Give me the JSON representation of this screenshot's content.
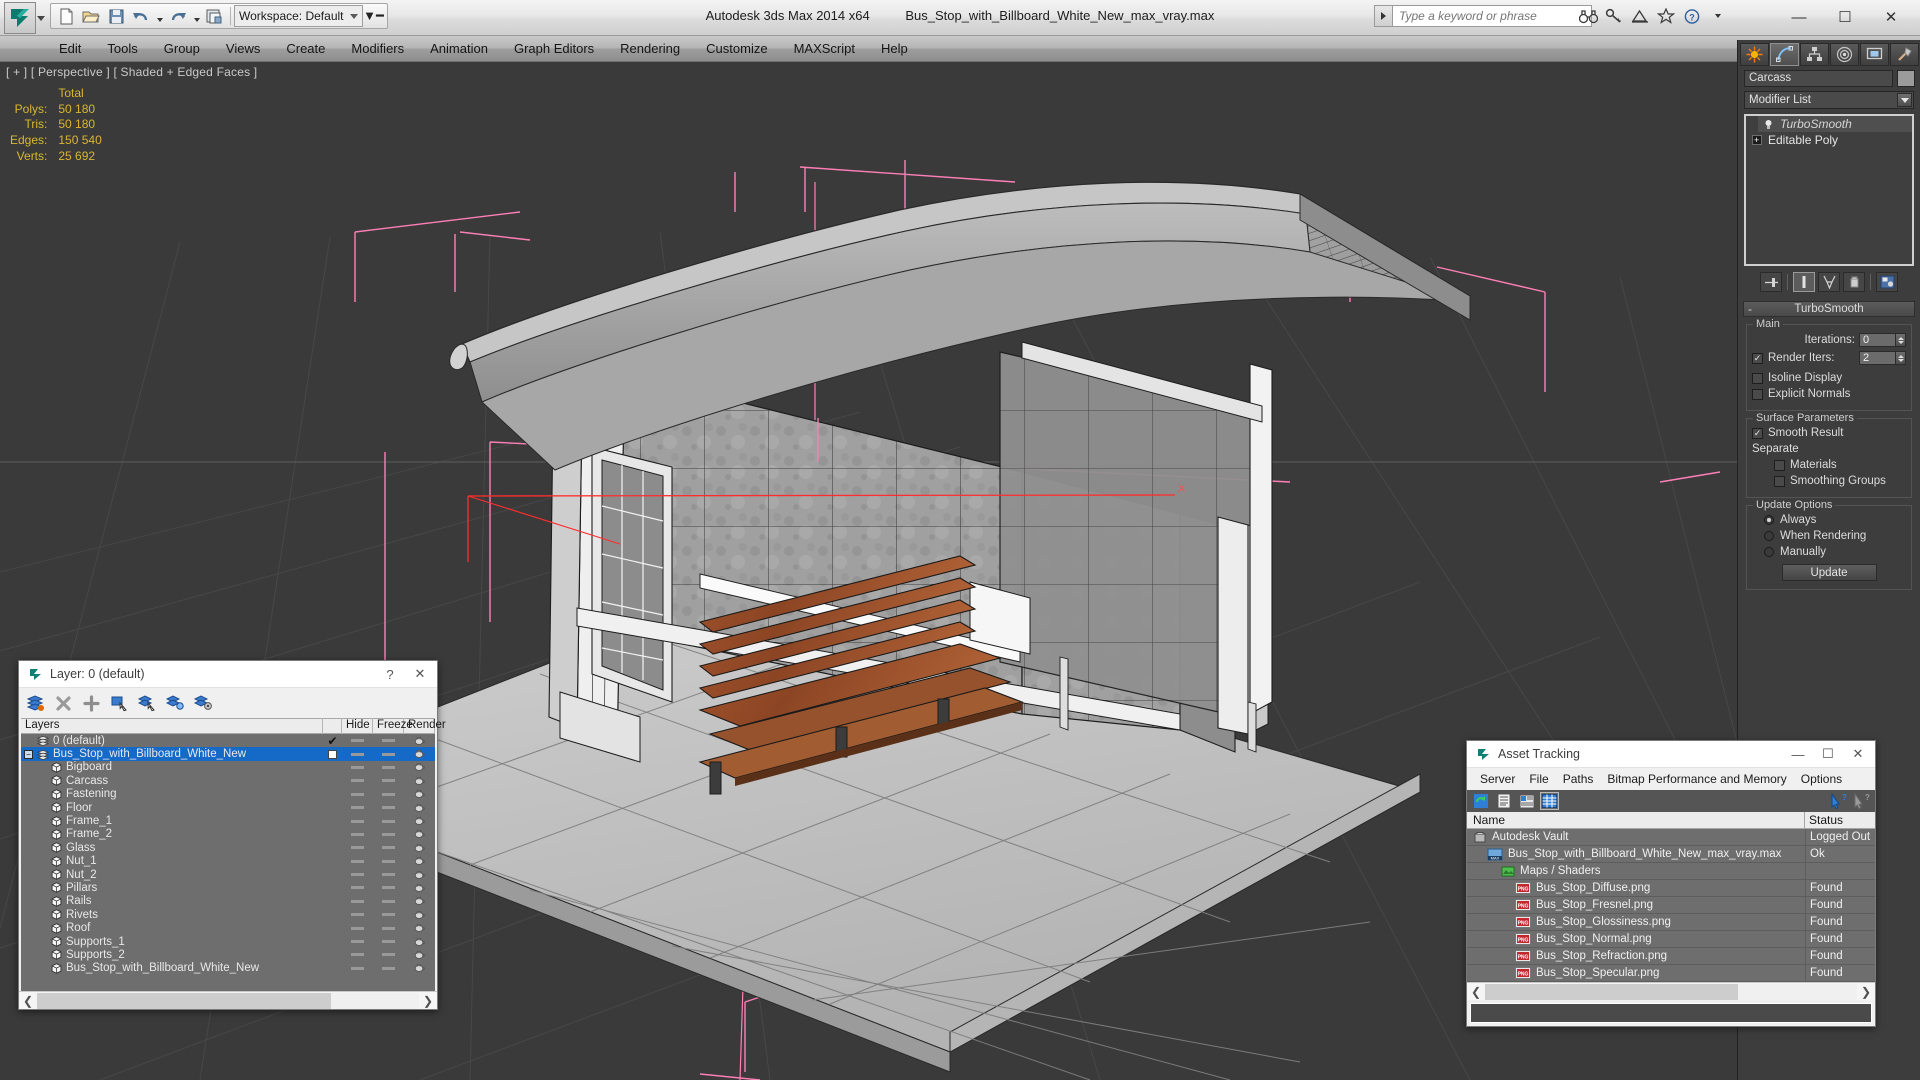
{
  "app": {
    "title": "Autodesk 3ds Max  2014 x64",
    "file": "Bus_Stop_with_Billboard_White_New_max_vray.max",
    "workspace_label": "Workspace: Default",
    "search_placeholder": "Type a keyword or phrase"
  },
  "quick_access": [
    {
      "name": "new-file-icon",
      "label": "New"
    },
    {
      "name": "open-file-icon",
      "label": "Open"
    },
    {
      "name": "save-file-icon",
      "label": "Save"
    },
    {
      "name": "undo-icon",
      "label": "Undo"
    },
    {
      "name": "redo-icon",
      "label": "Redo"
    },
    {
      "name": "project-folder-icon",
      "label": "Set Project Folder"
    }
  ],
  "title_icons": [
    {
      "name": "binoculars-icon"
    },
    {
      "name": "key-icon"
    },
    {
      "name": "satellite-dish-icon"
    },
    {
      "name": "star-icon"
    },
    {
      "name": "help-circle-icon"
    }
  ],
  "window_buttons": {
    "minimize": "—",
    "maximize": "☐",
    "close": "✕"
  },
  "menu": [
    "Edit",
    "Tools",
    "Group",
    "Views",
    "Create",
    "Modifiers",
    "Animation",
    "Graph Editors",
    "Rendering",
    "Customize",
    "MAXScript",
    "Help"
  ],
  "viewport": {
    "label": "[ + ] [ Perspective ] [ Shaded + Edged Faces ]",
    "stats_header": "Total",
    "stats": [
      {
        "label": "Polys:",
        "value": "50 180"
      },
      {
        "label": "Tris:",
        "value": "50 180"
      },
      {
        "label": "Edges:",
        "value": "150 540"
      },
      {
        "label": "Verts:",
        "value": "25 692"
      }
    ],
    "axis_label_x": "X",
    "colors": {
      "background": "#3a3a3a",
      "selection_bracket": "#ff7fb7",
      "gizmo_x": "#ff2d2d",
      "gizmo_z": "#ff7fb7",
      "stats_text": "#d8b72e",
      "wood": "#8f4a27",
      "floor": "#c4c4c4",
      "wall": "#9a9a9a",
      "roof": "#a9a9a9"
    }
  },
  "command_panel": {
    "tabs": [
      {
        "name": "create-tab",
        "icon": "star-burst-icon",
        "active": false
      },
      {
        "name": "modify-tab",
        "icon": "curve-icon",
        "active": true
      },
      {
        "name": "hierarchy-tab",
        "icon": "hierarchy-icon",
        "active": false
      },
      {
        "name": "motion-tab",
        "icon": "motion-icon",
        "active": false
      },
      {
        "name": "display-tab",
        "icon": "display-icon",
        "active": false
      },
      {
        "name": "utilities-tab",
        "icon": "hammer-icon",
        "active": false
      }
    ],
    "object_name": "Carcass",
    "modifier_list_label": "Modifier List",
    "stack": [
      {
        "label": "TurboSmooth",
        "selected": true,
        "icon": "lightbulb-icon"
      },
      {
        "label": "Editable Poly",
        "selected": false,
        "icon": "plus-box-icon"
      }
    ],
    "stack_buttons": [
      {
        "name": "pin-stack-button"
      },
      {
        "name": "show-end-result-button",
        "active": true
      },
      {
        "name": "make-unique-button"
      },
      {
        "name": "remove-modifier-button"
      },
      {
        "name": "configure-modifier-sets-button"
      }
    ],
    "rollout": {
      "title": "TurboSmooth",
      "groups": {
        "main": {
          "title": "Main",
          "iterations_label": "Iterations:",
          "iterations_value": "0",
          "render_iters_label": "Render Iters:",
          "render_iters_value": "2",
          "render_iters_checked": true,
          "isoline_display_label": "Isoline Display",
          "isoline_display_checked": false,
          "explicit_normals_label": "Explicit Normals",
          "explicit_normals_checked": false
        },
        "surface": {
          "title": "Surface Parameters",
          "smooth_result_label": "Smooth Result",
          "smooth_result_checked": true,
          "separate_label": "Separate",
          "materials_label": "Materials",
          "materials_checked": false,
          "smoothing_groups_label": "Smoothing Groups",
          "smoothing_groups_checked": false
        },
        "update": {
          "title": "Update Options",
          "options": [
            "Always",
            "When Rendering",
            "Manually"
          ],
          "selected": "Always",
          "update_button": "Update"
        }
      }
    }
  },
  "layer_dialog": {
    "title": "Layer: 0 (default)",
    "help_btn": "?",
    "close_btn": "✕",
    "toolbar": [
      {
        "name": "create-new-layer-icon"
      },
      {
        "name": "delete-layer-icon"
      },
      {
        "name": "add-selection-to-layer-icon"
      },
      {
        "name": "select-objects-in-layer-icon"
      },
      {
        "name": "select-highlighted-objects-icon"
      },
      {
        "name": "highlight-selected-objects-icon"
      },
      {
        "name": "layer-properties-icon"
      }
    ],
    "columns": [
      "Layers",
      "",
      "Hide",
      "Freeze",
      "Render"
    ],
    "rows": [
      {
        "label": "0 (default)",
        "indent": 0,
        "type": "layer",
        "selected": false,
        "current": true,
        "expander": false
      },
      {
        "label": "Bus_Stop_with_Billboard_White_New",
        "indent": 0,
        "type": "layer",
        "selected": true,
        "current": false,
        "expander": true
      },
      {
        "label": "Bigboard",
        "indent": 1,
        "type": "object"
      },
      {
        "label": "Carcass",
        "indent": 1,
        "type": "object"
      },
      {
        "label": "Fastening",
        "indent": 1,
        "type": "object"
      },
      {
        "label": "Floor",
        "indent": 1,
        "type": "object"
      },
      {
        "label": "Frame_1",
        "indent": 1,
        "type": "object"
      },
      {
        "label": "Frame_2",
        "indent": 1,
        "type": "object"
      },
      {
        "label": "Glass",
        "indent": 1,
        "type": "object"
      },
      {
        "label": "Nut_1",
        "indent": 1,
        "type": "object"
      },
      {
        "label": "Nut_2",
        "indent": 1,
        "type": "object"
      },
      {
        "label": "Pillars",
        "indent": 1,
        "type": "object"
      },
      {
        "label": "Rails",
        "indent": 1,
        "type": "object"
      },
      {
        "label": "Rivets",
        "indent": 1,
        "type": "object"
      },
      {
        "label": "Roof",
        "indent": 1,
        "type": "object"
      },
      {
        "label": "Supports_1",
        "indent": 1,
        "type": "object"
      },
      {
        "label": "Supports_2",
        "indent": 1,
        "type": "object"
      },
      {
        "label": "Bus_Stop_with_Billboard_White_New",
        "indent": 1,
        "type": "object"
      }
    ]
  },
  "asset_tracking": {
    "title": "Asset Tracking",
    "window_buttons": {
      "minimize": "—",
      "maximize": "☐",
      "close": "✕"
    },
    "menu": [
      "Server",
      "File",
      "Paths",
      "Bitmap Performance and Memory",
      "Options"
    ],
    "toolbar": [
      {
        "name": "refresh-icon"
      },
      {
        "name": "list-view-icon"
      },
      {
        "name": "detail-view-icon"
      },
      {
        "name": "grid-view-icon",
        "active": true
      },
      {
        "name": "help-pointer-icon"
      },
      {
        "name": "context-help-icon"
      }
    ],
    "columns": [
      "Name",
      "Status"
    ],
    "rows": [
      {
        "name": "Autodesk Vault",
        "status": "Logged Out",
        "indent": 0,
        "icon": "vault-icon"
      },
      {
        "name": "Bus_Stop_with_Billboard_White_New_max_vray.max",
        "status": "Ok",
        "indent": 1,
        "icon": "max-file-icon"
      },
      {
        "name": "Maps / Shaders",
        "status": "",
        "indent": 2,
        "icon": "maps-shaders-icon"
      },
      {
        "name": "Bus_Stop_Diffuse.png",
        "status": "Found",
        "indent": 3,
        "icon": "png-icon"
      },
      {
        "name": "Bus_Stop_Fresnel.png",
        "status": "Found",
        "indent": 3,
        "icon": "png-icon"
      },
      {
        "name": "Bus_Stop_Glossiness.png",
        "status": "Found",
        "indent": 3,
        "icon": "png-icon"
      },
      {
        "name": "Bus_Stop_Normal.png",
        "status": "Found",
        "indent": 3,
        "icon": "png-icon"
      },
      {
        "name": "Bus_Stop_Refraction.png",
        "status": "Found",
        "indent": 3,
        "icon": "png-icon"
      },
      {
        "name": "Bus_Stop_Specular.png",
        "status": "Found",
        "indent": 3,
        "icon": "png-icon"
      }
    ]
  }
}
